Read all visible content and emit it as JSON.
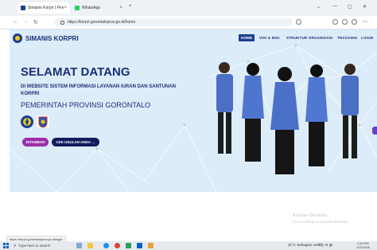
{
  "browser": {
    "tabs": [
      {
        "title": "Simanis Korpri | Pemerintah Provinsi Gorontalo",
        "active": true
      },
      {
        "title": "WhatsApp",
        "active": false
      }
    ],
    "new_tab": "+",
    "window_controls": [
      "⌄",
      "—",
      "▢",
      "✕"
    ],
    "url": "https://korpri.gorontaloprov.go.id/home"
  },
  "site": {
    "brand": "SIMANIS KORPRI",
    "menu": [
      "HOME",
      "VISI & MISI",
      "STRUKTUR ORGANISASI",
      "TRACKING",
      "LOGIN"
    ],
    "hero": {
      "title": "SELAMAT DATANG",
      "subtitle": "DI WEBSITE SISTEM INFORMASI LAYANAN IURAN DAN SANTUNAN KORPRI",
      "province": "PEMERINTAH PROVINSI GORONTALO"
    },
    "buttons": {
      "primary": "DITAMBAH",
      "secondary": "CEK USULAN ANDA →"
    }
  },
  "status_url": "https://korpri.gorontaloprov.go.id/login",
  "watermark": {
    "line1": "Activate Windows",
    "line2": "Go to Settings to activate Windows."
  },
  "taskbar": {
    "search_placeholder": "Type here to search",
    "weather": "31°C  Sebagian cerah",
    "systray": "^  ◫  ⌯  🔊",
    "time": "4:16 PM",
    "date": "1/13/2025"
  },
  "colors": {
    "brand_blue": "#1c2e7a",
    "button_purple": "#9b2fa8",
    "button_navy": "#121d5e",
    "hero_bg": "#dcecf9"
  }
}
